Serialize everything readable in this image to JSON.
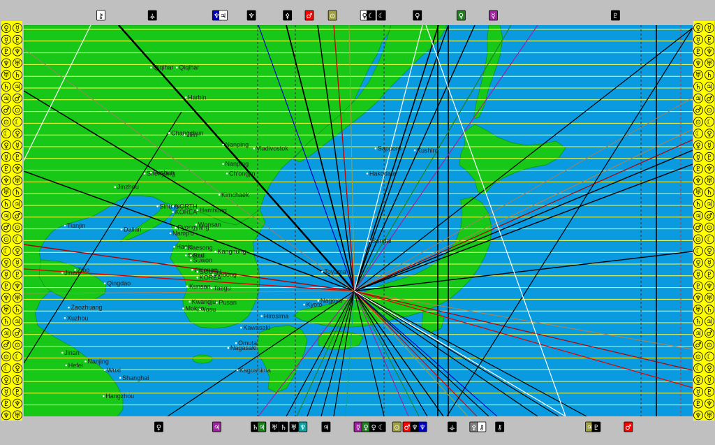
{
  "map": {
    "colors": {
      "water": "#0a9ae0",
      "land": "#18c818",
      "frame": "#c0c0c0",
      "gridline": "#ffff40",
      "sidebar": "#ffff00"
    },
    "cities": [
      {
        "name": "Qiqihar",
        "lon": 123.9,
        "lat": 47.3
      },
      {
        "name": "Qiqihar",
        "lon": 125.9,
        "lat": 47.3
      },
      {
        "name": "Harbin",
        "lon": 126.6,
        "lat": 45.75
      },
      {
        "name": "Changchun",
        "lon": 125.3,
        "lat": 43.9
      },
      {
        "name": "Jilin",
        "lon": 126.5,
        "lat": 43.8
      },
      {
        "name": "Nanping",
        "lon": 129.5,
        "lat": 43.3
      },
      {
        "name": "Vladivostok",
        "lon": 131.9,
        "lat": 43.1
      },
      {
        "name": "Nanping",
        "lon": 129.5,
        "lat": 42.3
      },
      {
        "name": "Ch'ongjin",
        "lon": 129.8,
        "lat": 41.8
      },
      {
        "name": "Shenyang",
        "lon": 123.4,
        "lat": 41.8
      },
      {
        "name": "Fushun",
        "lon": 123.9,
        "lat": 41.85
      },
      {
        "name": "Jinzhou",
        "lon": 121.1,
        "lat": 41.1
      },
      {
        "name": "Kimchaek",
        "lon": 129.2,
        "lat": 40.7
      },
      {
        "name": "Sinuiju",
        "lon": 124.4,
        "lat": 40.1
      },
      {
        "name": "NORTH",
        "lon": 125.6,
        "lat": 40.1
      },
      {
        "name": "KOREA",
        "lon": 125.6,
        "lat": 39.8
      },
      {
        "name": "Hamhung",
        "lon": 127.5,
        "lat": 39.9
      },
      {
        "name": "Tianjin",
        "lon": 117.2,
        "lat": 39.1
      },
      {
        "name": "Dalian",
        "lon": 121.6,
        "lat": 38.9
      },
      {
        "name": "Pyongyang",
        "lon": 125.8,
        "lat": 39.0
      },
      {
        "name": "Wonsan",
        "lon": 127.4,
        "lat": 39.15
      },
      {
        "name": "Namp'o",
        "lon": 125.4,
        "lat": 38.7
      },
      {
        "name": "Haeju",
        "lon": 125.7,
        "lat": 38.0
      },
      {
        "name": "Kaesong",
        "lon": 126.6,
        "lat": 37.95
      },
      {
        "name": "Seoul",
        "lon": 126.6,
        "lat": 37.55
      },
      {
        "name": "Soul",
        "lon": 127.0,
        "lat": 37.55
      },
      {
        "name": "Suwon",
        "lon": 127.0,
        "lat": 37.3
      },
      {
        "name": "Kangnung",
        "lon": 128.9,
        "lat": 37.75
      },
      {
        "name": "Zibo",
        "lon": 118.0,
        "lat": 36.8
      },
      {
        "name": "Ch'onan",
        "lon": 127.1,
        "lat": 36.8
      },
      {
        "name": "SOUTH",
        "lon": 127.5,
        "lat": 36.7
      },
      {
        "name": "KOREA",
        "lon": 127.5,
        "lat": 36.4
      },
      {
        "name": "Andong",
        "lon": 128.7,
        "lat": 36.55
      },
      {
        "name": "Kunsan",
        "lon": 126.7,
        "lat": 35.95
      },
      {
        "name": "Taegu",
        "lon": 128.6,
        "lat": 35.85
      },
      {
        "name": "Kwangju",
        "lon": 126.9,
        "lat": 35.15
      },
      {
        "name": "Mokpo",
        "lon": 126.4,
        "lat": 34.8
      },
      {
        "name": "Yosu",
        "lon": 127.7,
        "lat": 34.75
      },
      {
        "name": "Pusan",
        "lon": 129.0,
        "lat": 35.1
      },
      {
        "name": "Zaozhuang",
        "lon": 117.5,
        "lat": 34.85
      },
      {
        "name": "Qingdao",
        "lon": 120.3,
        "lat": 36.1
      },
      {
        "name": "Hirosima",
        "lon": 132.5,
        "lat": 34.4
      },
      {
        "name": "Kawasaki",
        "lon": 130.9,
        "lat": 33.8
      },
      {
        "name": "Nagasaki",
        "lon": 129.9,
        "lat": 32.75
      },
      {
        "name": "Omuta",
        "lon": 130.5,
        "lat": 33.0
      },
      {
        "name": "Kagoshima",
        "lon": 130.6,
        "lat": 31.6
      },
      {
        "name": "Kyoto",
        "lon": 135.8,
        "lat": 35.0
      },
      {
        "name": "Nagoya",
        "lon": 136.9,
        "lat": 35.2
      },
      {
        "name": "Toyama",
        "lon": 137.2,
        "lat": 36.7
      },
      {
        "name": "Sendai",
        "lon": 140.9,
        "lat": 38.3
      },
      {
        "name": "Sapporo",
        "lon": 141.35,
        "lat": 43.1
      },
      {
        "name": "Kushiro",
        "lon": 144.4,
        "lat": 43.0
      },
      {
        "name": "Hakodate",
        "lon": 140.7,
        "lat": 41.8
      },
      {
        "name": "Nanjing",
        "lon": 118.8,
        "lat": 32.05
      },
      {
        "name": "Hefei",
        "lon": 117.3,
        "lat": 31.85
      },
      {
        "name": "Wuxi",
        "lon": 120.3,
        "lat": 31.6
      },
      {
        "name": "Shanghai",
        "lon": 121.5,
        "lat": 31.2
      },
      {
        "name": "Hangzhou",
        "lon": 120.2,
        "lat": 30.25
      },
      {
        "name": "Xuzhou",
        "lon": 117.2,
        "lat": 34.3
      },
      {
        "name": "Jinan",
        "lon": 117.0,
        "lat": 36.65
      },
      {
        "name": "Jinan",
        "lon": 117.0,
        "lat": 32.5
      }
    ],
    "center": {
      "lon": 139.7,
      "lat": 35.7
    },
    "top_glyphs": [
      {
        "lon": 120.0,
        "text": "⚷",
        "color": "#ffffff"
      },
      {
        "lon": 124.0,
        "text": "⚶",
        "color": "#000000"
      },
      {
        "lon": 129.0,
        "text": "♆",
        "color": "#0000c0"
      },
      {
        "lon": 129.5,
        "text": "♃",
        "color": "#ffffff"
      },
      {
        "lon": 131.7,
        "text": "♆",
        "color": "#000000"
      },
      {
        "lon": 134.5,
        "text": "⚴",
        "color": "#000000"
      },
      {
        "lon": 136.2,
        "text": "♂",
        "color": "#ff0000"
      },
      {
        "lon": 138.0,
        "text": "⊙",
        "color": "#a0a040"
      },
      {
        "lon": 140.5,
        "text": "♀",
        "color": "#ffffff"
      },
      {
        "lon": 141.0,
        "text": "☾",
        "color": "#000000"
      },
      {
        "lon": 141.8,
        "text": "☾",
        "color": "#000000"
      },
      {
        "lon": 144.6,
        "text": "♀",
        "color": "#000000"
      },
      {
        "lon": 148.0,
        "text": "♀",
        "color": "#208020"
      },
      {
        "lon": 150.5,
        "text": "☿",
        "color": "#a020a0"
      },
      {
        "lon": 160.0,
        "text": "♇",
        "color": "#000000"
      }
    ],
    "bottom_glyphs": [
      {
        "lon": 124.5,
        "text": "♀",
        "color": "#000000"
      },
      {
        "lon": 129.0,
        "text": "♃",
        "color": "#a020a0"
      },
      {
        "lon": 132.0,
        "text": "♄",
        "color": "#000000"
      },
      {
        "lon": 132.5,
        "text": "♃",
        "color": "#208020"
      },
      {
        "lon": 133.5,
        "text": "♅",
        "color": "#000000"
      },
      {
        "lon": 134.2,
        "text": "♄",
        "color": "#000000"
      },
      {
        "lon": 135.0,
        "text": "♅",
        "color": "#000000"
      },
      {
        "lon": 135.7,
        "text": "♆",
        "color": "#10a0a0"
      },
      {
        "lon": 137.5,
        "text": "♃",
        "color": "#000000"
      },
      {
        "lon": 140.0,
        "text": "☿",
        "color": "#a020a0"
      },
      {
        "lon": 140.6,
        "text": "♀",
        "color": "#208020"
      },
      {
        "lon": 141.2,
        "text": "♀",
        "color": "#000000"
      },
      {
        "lon": 141.8,
        "text": "☾",
        "color": "#000000"
      },
      {
        "lon": 143.0,
        "text": "⊙",
        "color": "#a0a040"
      },
      {
        "lon": 143.8,
        "text": "♂",
        "color": "#ff0000"
      },
      {
        "lon": 144.4,
        "text": "♆",
        "color": "#000000"
      },
      {
        "lon": 145.0,
        "text": "♆",
        "color": "#0000c0"
      },
      {
        "lon": 147.3,
        "text": "⚶",
        "color": "#000000"
      },
      {
        "lon": 149.0,
        "text": "⚴",
        "color": "#808080"
      },
      {
        "lon": 149.6,
        "text": "⚷",
        "color": "#ffffff"
      },
      {
        "lon": 151.0,
        "text": "⚷",
        "color": "#000000"
      },
      {
        "lon": 158.0,
        "text": "♃",
        "color": "#a0a040"
      },
      {
        "lon": 158.5,
        "text": "♇",
        "color": "#000000"
      },
      {
        "lon": 161.0,
        "text": "♂",
        "color": "#ff0000"
      }
    ]
  }
}
